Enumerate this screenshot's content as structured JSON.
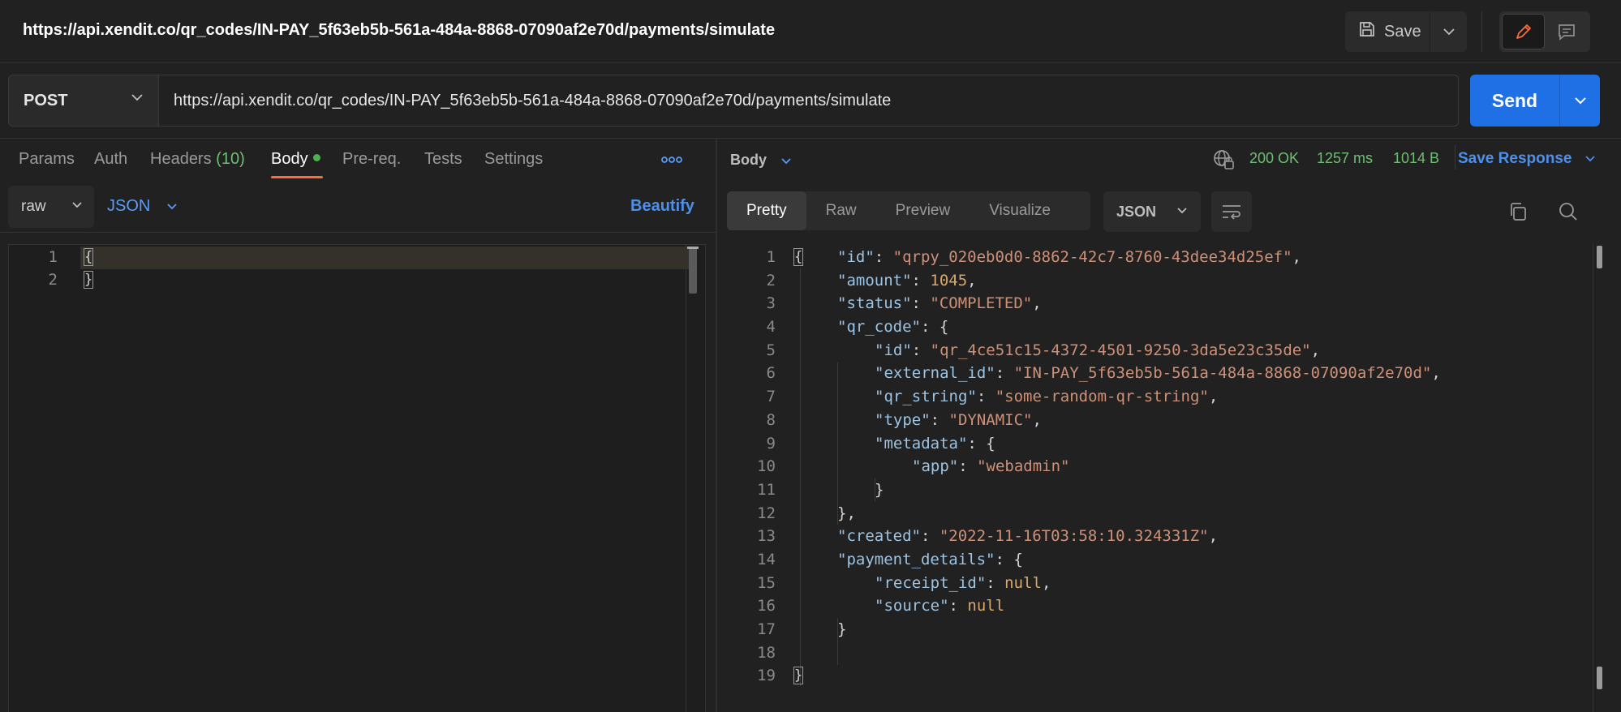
{
  "title_bar": {
    "request_url": "https://api.xendit.co/qr_codes/IN-PAY_5f63eb5b-561a-484a-8868-07090af2e70d/payments/simulate",
    "save_label": "Save",
    "icons": {
      "save": "save-disk-icon",
      "edit": "pencil-icon",
      "comments": "comment-icon"
    }
  },
  "request": {
    "method": "POST",
    "url": "https://api.xendit.co/qr_codes/IN-PAY_5f63eb5b-561a-484a-8868-07090af2e70d/payments/simulate",
    "send_label": "Send",
    "tabs": [
      {
        "label": "Params"
      },
      {
        "label": "Auth"
      },
      {
        "label": "Headers",
        "count": "(10)"
      },
      {
        "label": "Body",
        "active": true
      },
      {
        "label": "Pre-req."
      },
      {
        "label": "Tests"
      },
      {
        "label": "Settings"
      }
    ],
    "body_mode": "raw",
    "body_format": "JSON",
    "beautify_label": "Beautify",
    "editor_lines": [
      "1",
      "2"
    ],
    "editor_content": [
      "{",
      "}"
    ]
  },
  "response": {
    "section_label": "Body",
    "status": "200 OK",
    "time": "1257 ms",
    "size": "1014 B",
    "save_response_label": "Save Response",
    "view_tabs": [
      "Pretty",
      "Raw",
      "Preview",
      "Visualize"
    ],
    "active_view": "Pretty",
    "format": "JSON",
    "line_numbers": [
      "1",
      "2",
      "3",
      "4",
      "5",
      "6",
      "7",
      "8",
      "9",
      "10",
      "11",
      "12",
      "13",
      "14",
      "15",
      "16",
      "17",
      "18",
      "19"
    ],
    "body": {
      "id_key": "\"id\"",
      "id_val": "\"qrpy_020eb0d0-8862-42c7-8760-43dee34d25ef\"",
      "amount_key": "\"amount\"",
      "amount_val": "1045",
      "status_key": "\"status\"",
      "status_val": "\"COMPLETED\"",
      "qr_code_key": "\"qr_code\"",
      "qr_id_key": "\"id\"",
      "qr_id_val": "\"qr_4ce51c15-4372-4501-9250-3da5e23c35de\"",
      "external_id_key": "\"external_id\"",
      "external_id_val": "\"IN-PAY_5f63eb5b-561a-484a-8868-07090af2e70d\"",
      "qr_string_key": "\"qr_string\"",
      "qr_string_val": "\"some-random-qr-string\"",
      "type_key": "\"type\"",
      "type_val": "\"DYNAMIC\"",
      "metadata_key": "\"metadata\"",
      "app_key": "\"app\"",
      "app_val": "\"webadmin\"",
      "created_key": "\"created\"",
      "created_val": "\"2022-11-16T03:58:10.324331Z\"",
      "payment_details_key": "\"payment_details\"",
      "receipt_id_key": "\"receipt_id\"",
      "receipt_id_val": "null",
      "source_key": "\"source\"",
      "source_val": "null"
    }
  },
  "colors": {
    "accent_orange": "#ff6c37",
    "send_blue": "#1f6fe5",
    "status_green": "#6fbf73",
    "link_blue": "#4d8fea",
    "json_key": "#9cc4e4",
    "json_string": "#ce9178"
  }
}
